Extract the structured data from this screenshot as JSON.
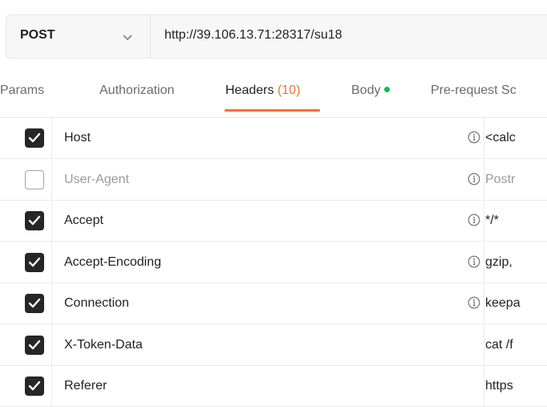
{
  "request": {
    "method": "POST",
    "url": "http://39.106.13.71:28317/su18"
  },
  "tabs": [
    {
      "label": "Params"
    },
    {
      "label": "Authorization"
    },
    {
      "label": "Headers",
      "count": "(10)",
      "active": true
    },
    {
      "label": "Body",
      "indicator": "green-dot"
    },
    {
      "label": "Pre-request Sc"
    }
  ],
  "headers": [
    {
      "checked": true,
      "key": "Host",
      "value": "<calc",
      "info": true
    },
    {
      "checked": false,
      "key": "User-Agent",
      "value": "Postr",
      "info": true
    },
    {
      "checked": true,
      "key": "Accept",
      "value": "*/*",
      "info": true
    },
    {
      "checked": true,
      "key": "Accept-Encoding",
      "value": "gzip,",
      "info": true
    },
    {
      "checked": true,
      "key": "Connection",
      "value": "keepa",
      "info": true
    },
    {
      "checked": true,
      "key": "X-Token-Data",
      "value": "cat /f",
      "info": false
    },
    {
      "checked": true,
      "key": "Referer",
      "value": "https",
      "info": false
    }
  ],
  "colors": {
    "accent": "#ff6c37",
    "count": "#e8762b",
    "body_indicator": "#0cbb52",
    "checkbox": "#262626"
  }
}
